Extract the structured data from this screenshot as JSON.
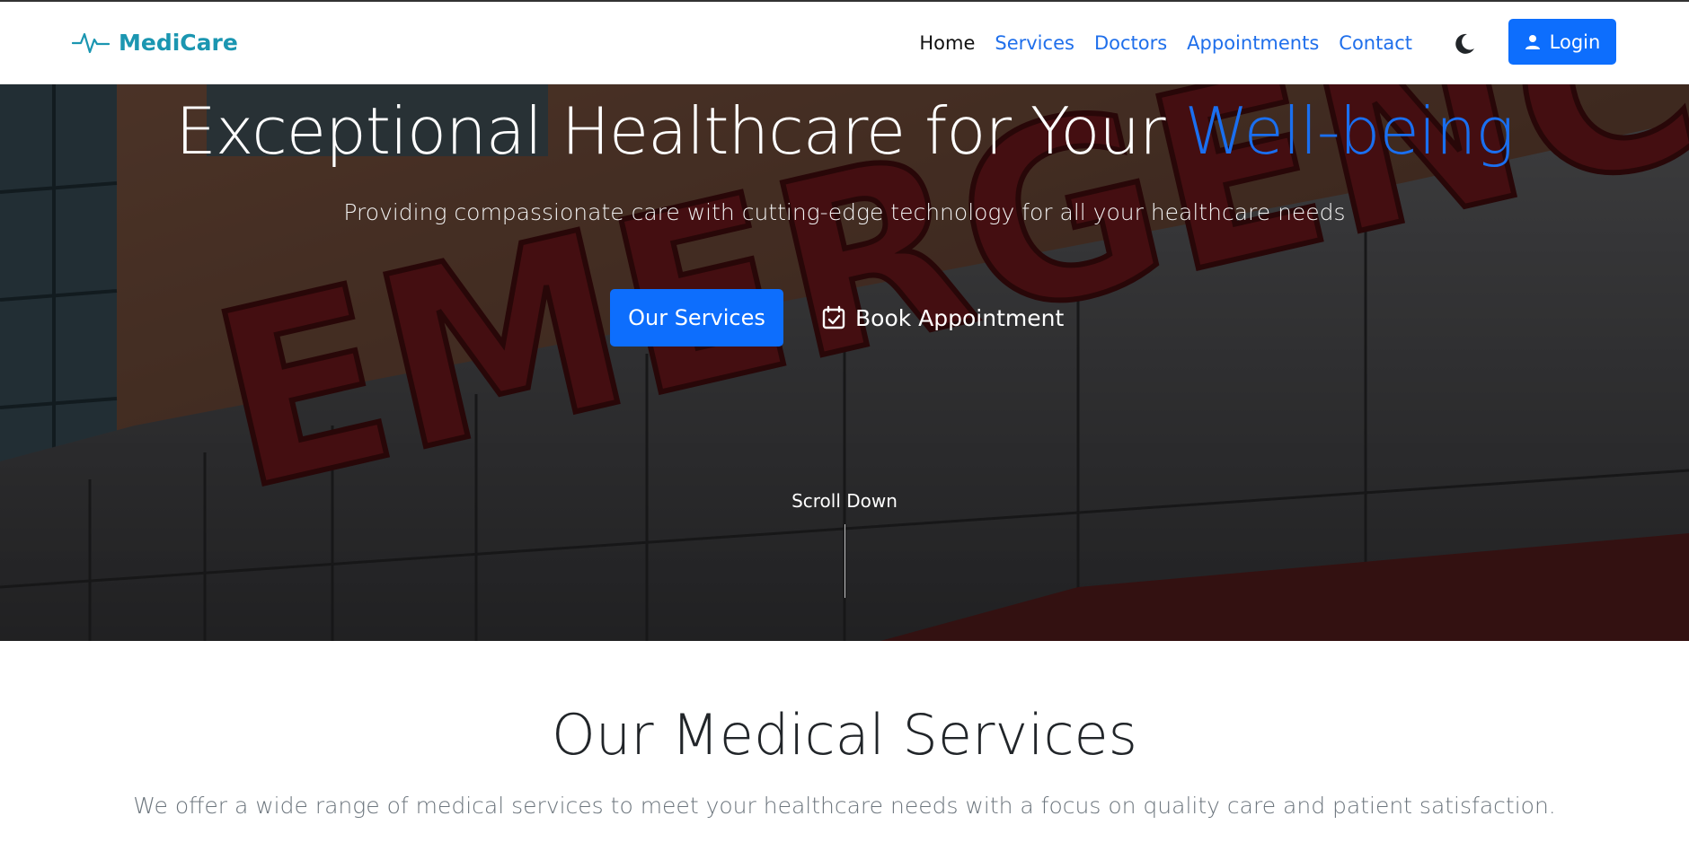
{
  "navbar": {
    "brand": "MediCare",
    "links": [
      {
        "label": "Home",
        "active": true
      },
      {
        "label": "Services",
        "active": false
      },
      {
        "label": "Doctors",
        "active": false
      },
      {
        "label": "Appointments",
        "active": false
      },
      {
        "label": "Contact",
        "active": false
      }
    ],
    "theme_icon": "moon-icon",
    "login_label": "Login",
    "login_icon": "user-icon"
  },
  "hero": {
    "title_main": "Exceptional Healthcare for Your ",
    "title_accent": "Well-being",
    "subtitle": "Providing compassionate care with cutting-edge technology for all your healthcare needs",
    "primary_button": "Our Services",
    "secondary_button": "Book Appointment",
    "secondary_icon": "calendar-check-icon",
    "scroll_label": "Scroll Down",
    "background_sign_text": "EMERGENCY"
  },
  "services": {
    "title": "Our Medical Services",
    "description": "We offer a wide range of medical services to meet your healthcare needs with a focus on quality care and patient satisfaction."
  },
  "colors": {
    "brand": "#1b96b1",
    "primary": "#0d6efd",
    "accent_text": "#1a6ff0",
    "muted": "#6c757d"
  }
}
